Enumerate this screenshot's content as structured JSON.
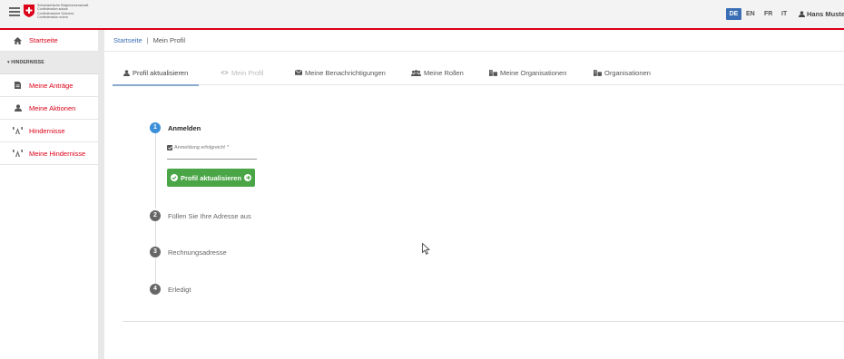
{
  "header": {
    "logo_lines": [
      "Schweizerische Eidgenossenschaft",
      "Confédération suisse",
      "Confederazione Svizzera",
      "Confederaziun svizra"
    ],
    "languages": [
      {
        "code": "DE",
        "active": true
      },
      {
        "code": "EN",
        "active": false
      },
      {
        "code": "FR",
        "active": false
      },
      {
        "code": "IT",
        "active": false
      }
    ],
    "user_name": "Hans Muste"
  },
  "sidebar": {
    "home": "Startseite",
    "section": "▾ HINDERNISSE",
    "items": [
      {
        "label": "Meine Anträge",
        "icon": "document-icon"
      },
      {
        "label": "Meine Aktionen",
        "icon": "user-icon"
      },
      {
        "label": "Hindernisse",
        "icon": "barrier-icon"
      },
      {
        "label": "Meine Hindernisse",
        "icon": "barrier-icon"
      }
    ]
  },
  "breadcrumb": {
    "home": "Startseite",
    "separator": "|",
    "current": "Mein Profil"
  },
  "tabs": [
    {
      "label": "Profil aktualisieren",
      "icon": "user-icon",
      "state": "active"
    },
    {
      "label": "Mein Profil",
      "icon": "eye-icon",
      "state": "disabled"
    },
    {
      "label": "Meine Benachrichtigungen",
      "icon": "envelope-icon",
      "state": "normal"
    },
    {
      "label": "Meine Rollen",
      "icon": "users-icon",
      "state": "normal"
    },
    {
      "label": "Meine Organisationen",
      "icon": "organization-icon",
      "state": "normal"
    },
    {
      "label": "Organisationen",
      "icon": "organization-icon",
      "state": "normal"
    }
  ],
  "stepper": {
    "steps": [
      {
        "number": "1",
        "label": "Anmelden",
        "active": true
      },
      {
        "number": "2",
        "label": "Füllen Sie Ihre Adresse aus",
        "active": false
      },
      {
        "number": "3",
        "label": "Rechnungsadresse",
        "active": false
      },
      {
        "number": "4",
        "label": "Erledigt",
        "active": false
      }
    ],
    "field_label": "Anmeldung erfolgreich! *",
    "button_label": "Profil aktualisieren"
  },
  "colors": {
    "brand_red": "#dc0018",
    "active_lang": "#3b6fb5",
    "step_active": "#3b8fd9",
    "button_green": "#4aa546"
  }
}
